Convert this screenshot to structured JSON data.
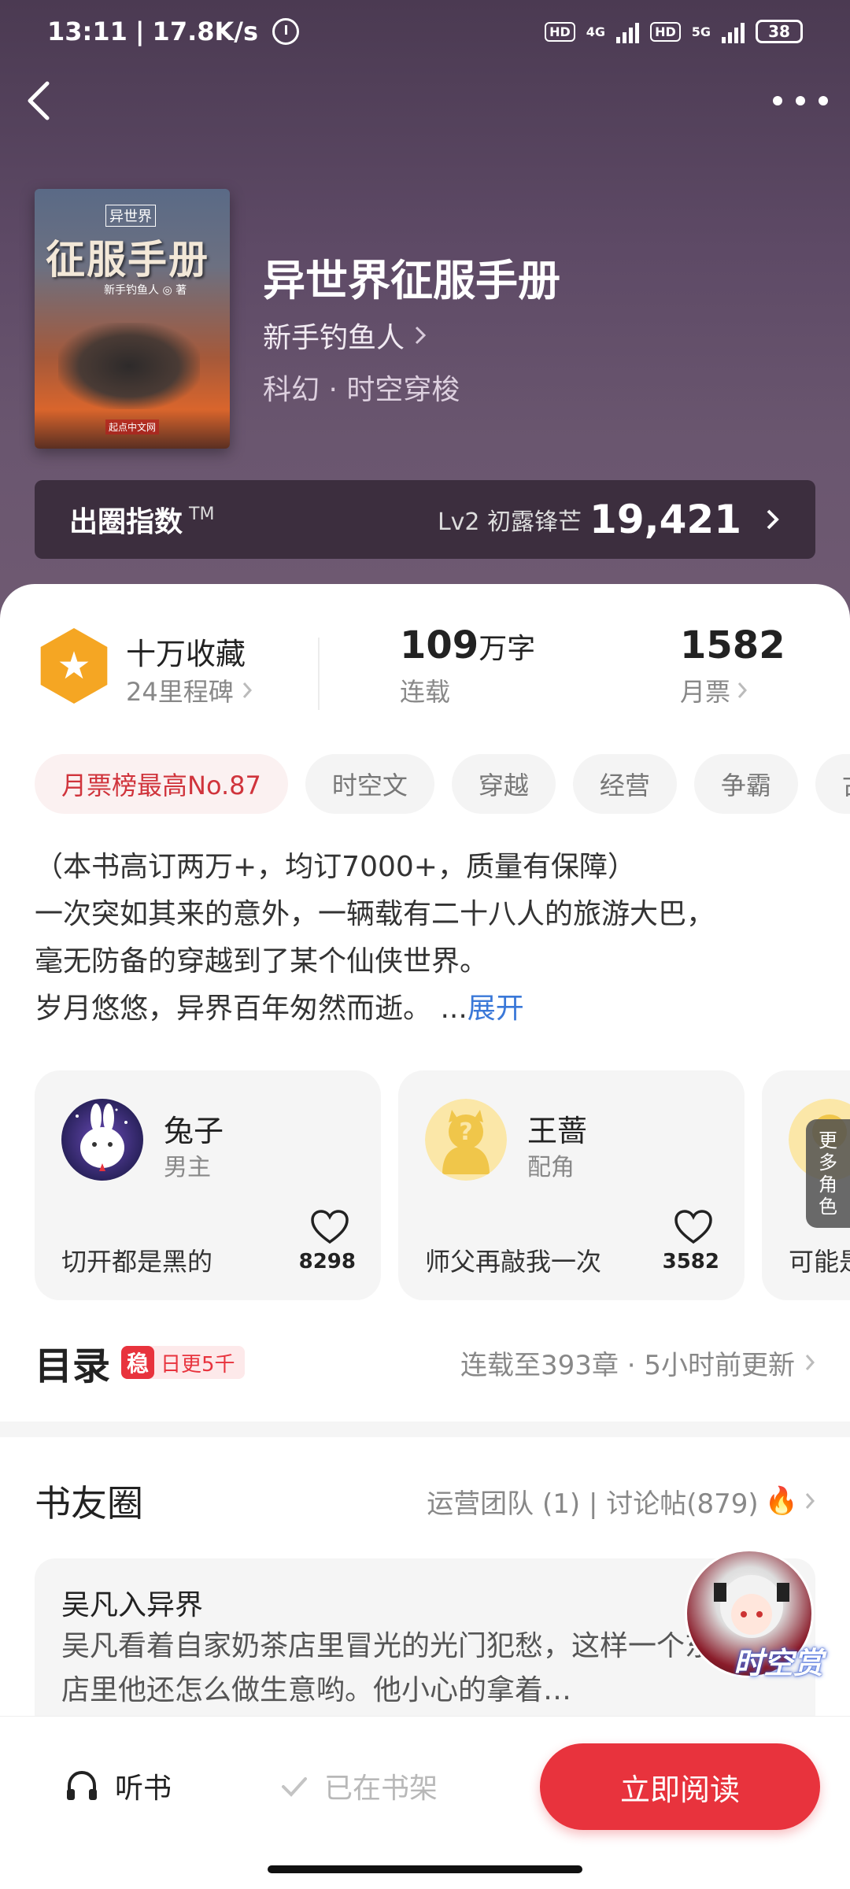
{
  "status_bar": {
    "time": "13:11",
    "speed": "17.8K/s",
    "hd1": "HD",
    "net1": "4G",
    "hd2": "HD",
    "net2": "5G",
    "battery": "38"
  },
  "book": {
    "cover_series": "异世界",
    "cover_title": "征服手册",
    "cover_author": "新手钓鱼人 ◎ 著",
    "cover_publisher": "起点中文网",
    "title": "异世界征服手册",
    "author": "新手钓鱼人",
    "genre": "科幻 · 时空穿梭"
  },
  "circle_index": {
    "label": "出圈指数",
    "tm": "TM",
    "level": "Lv2 初露锋芒",
    "score": "19,421"
  },
  "stats": {
    "collect_title": "十万收藏",
    "collect_sub": "24里程碑",
    "words_value": "109",
    "words_unit": "万字",
    "words_sub": "连载",
    "tickets_value": "1582",
    "tickets_sub": "月票"
  },
  "tags": [
    "月票榜最高No.87",
    "时空文",
    "穿越",
    "经营",
    "争霸",
    "古"
  ],
  "description": {
    "lines": [
      "（本书高订两万+，均订7000+，质量有保障）",
      "一次突如其来的意外，一辆载有二十八人的旅游大巴，",
      "毫无防备的穿越到了某个仙侠世界。",
      "岁月悠悠，异界百年匆然而逝。 ..."
    ],
    "expand": "展开"
  },
  "roles": [
    {
      "name": "兔子",
      "type": "男主",
      "quote": "切开都是黑的",
      "likes": "8298"
    },
    {
      "name": "王蔷",
      "type": "配角",
      "quote": "师父再敲我一次",
      "likes": "3582"
    },
    {
      "name": "",
      "type": "",
      "quote": "可能是",
      "likes": ""
    }
  ],
  "more_roles": [
    "更",
    "多",
    "角",
    "色"
  ],
  "catalog": {
    "title": "目录",
    "badge_icon": "稳",
    "badge_text": "日更5千",
    "info": "连载至393章 · 5小时前更新"
  },
  "book_circle": {
    "title": "书友圈",
    "info": "运营团队 (1) | 讨论帖(879)",
    "post_title": "吴凡入异界",
    "post_body": "吴凡看着自家奶茶店里冒光的光门犯愁，这样一个东西在店里他还怎么做生意哟。他小心的拿着…"
  },
  "float_badge": {
    "label": "时空赏"
  },
  "bottom_bar": {
    "listen": "听书",
    "shelf": "已在书架",
    "read": "立即阅读"
  },
  "colors": {
    "accent": "#e8333d",
    "link": "#3a78d8",
    "header_bg": "#5e4a66",
    "badge": "#f5a623"
  }
}
